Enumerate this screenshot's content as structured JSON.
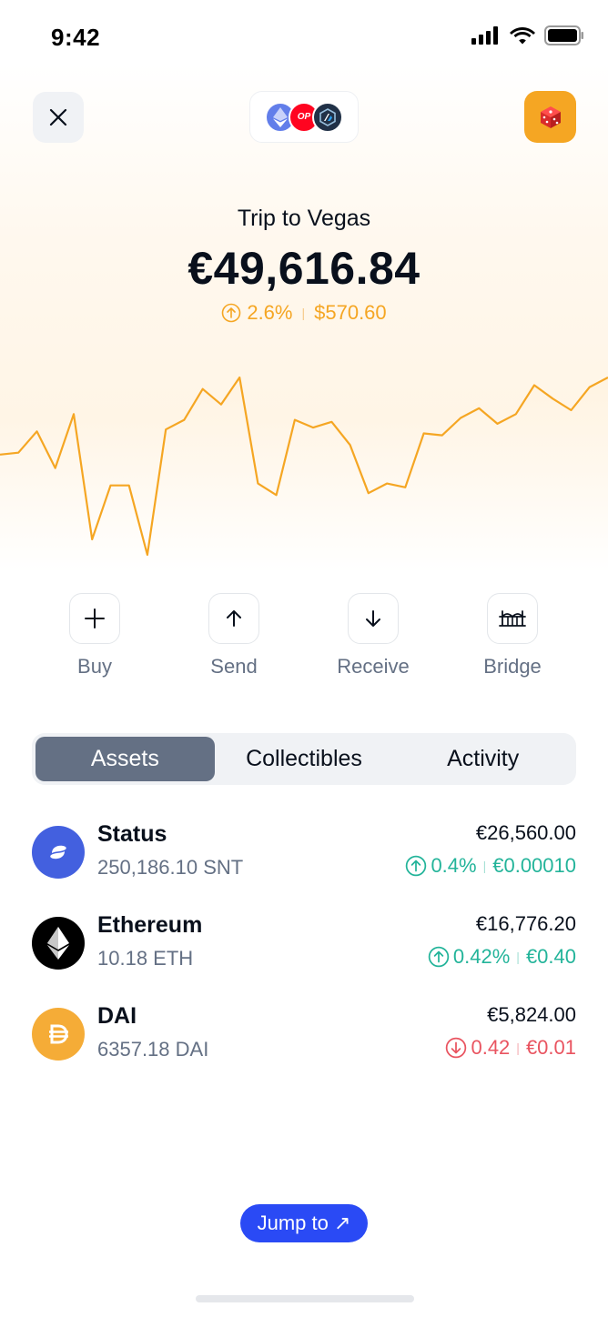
{
  "status_bar": {
    "time": "9:42"
  },
  "header": {
    "account_name": "Trip to Vegas",
    "balance": "€49,616.84",
    "change_percent": "2.6%",
    "change_value": "$570.60",
    "networks": [
      "ethereum",
      "optimism",
      "arbitrum"
    ],
    "optimism_label": "OP"
  },
  "chart_data": {
    "type": "line",
    "title": "",
    "xlabel": "",
    "ylabel": "",
    "grid": false,
    "color": "#f5a623",
    "series": [
      {
        "values": [
          52,
          53,
          64,
          45,
          73,
          8,
          36,
          36,
          0,
          65,
          70,
          86,
          78,
          92,
          37,
          31,
          70,
          66,
          69,
          57,
          32,
          37,
          35,
          63,
          62,
          71,
          76,
          68,
          73,
          88,
          81,
          75,
          87,
          92
        ]
      }
    ]
  },
  "actions": [
    {
      "label": "Buy",
      "icon": "plus-icon"
    },
    {
      "label": "Send",
      "icon": "arrow-up-icon"
    },
    {
      "label": "Receive",
      "icon": "arrow-down-icon"
    },
    {
      "label": "Bridge",
      "icon": "bridge-icon"
    }
  ],
  "tabs": [
    {
      "label": "Assets",
      "active": true
    },
    {
      "label": "Collectibles",
      "active": false
    },
    {
      "label": "Activity",
      "active": false
    }
  ],
  "assets": [
    {
      "name": "Status",
      "amount": "250,186.10 SNT",
      "fiat": "€26,560.00",
      "change_percent": "0.4%",
      "change_value": "€0.00010",
      "direction": "up",
      "logo_color": "#4360df"
    },
    {
      "name": "Ethereum",
      "amount": "10.18 ETH",
      "fiat": "€16,776.20",
      "change_percent": "0.42%",
      "change_value": "€0.40",
      "direction": "up",
      "logo_color": "#000000"
    },
    {
      "name": "DAI",
      "amount": "6357.18 DAI",
      "fiat": "€5,824.00",
      "change_percent": "0.42",
      "change_value": "€0.01",
      "direction": "down",
      "logo_color": "#f5ac37"
    }
  ],
  "jump_to": {
    "label": "Jump to ↗"
  },
  "colors": {
    "accent": "#f5a623",
    "positive": "#23b49a",
    "negative": "#e95460",
    "primary": "#2a4af5"
  }
}
